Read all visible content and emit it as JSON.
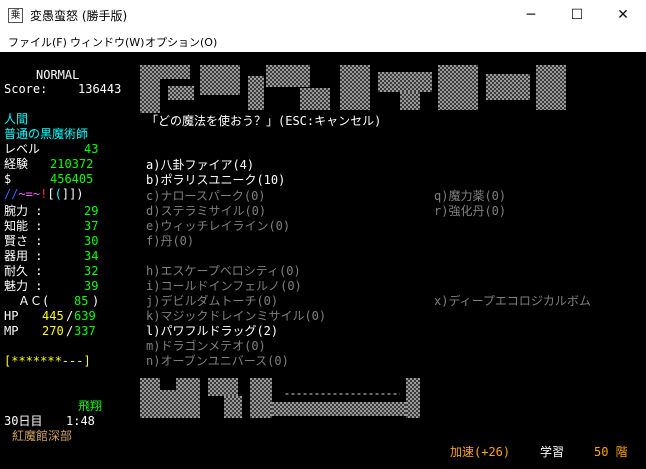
{
  "window": {
    "title": "変愚蛮怒 (勝手版)",
    "icon_glyph": "乗",
    "btn_minimize": "─",
    "btn_maximize": "☐",
    "btn_close": "✕"
  },
  "menu": {
    "file": "ファイル(F)",
    "window": "ウィンドウ(W)",
    "options": "オプション(O)"
  },
  "status": {
    "difficulty": "NORMAL",
    "score_label": "Score:",
    "score": "136443",
    "race": "人間",
    "class": "普通の黒魔術師",
    "level_label": "レベル",
    "level": "43",
    "exp_label": "経験",
    "exp": "210372",
    "gold_label": "$",
    "gold": "456405",
    "equip": "//~=~![(]])",
    "stats": [
      {
        "label": "腕力 :",
        "value": "29"
      },
      {
        "label": "知能 :",
        "value": "37"
      },
      {
        "label": "賢さ :",
        "value": "30"
      },
      {
        "label": "器用 :",
        "value": "34"
      },
      {
        "label": "耐久 :",
        "value": "32"
      },
      {
        "label": "魅力 :",
        "value": "39"
      }
    ],
    "ac_label": "ＡＣ(",
    "ac": "85",
    "ac_close": ")",
    "hp_label": "HP",
    "hp": "445",
    "hp_max": "639",
    "mp_label": "MP",
    "mp": "270",
    "mp_max": "337",
    "health_bar": "[*******---]",
    "flying": "飛翔",
    "day": "30日目",
    "time": "1:48",
    "location": "紅魔館深部"
  },
  "prompt": "「どの魔法を使おう？」(ESC:キャンセル)",
  "spells": {
    "a": "a)八卦ファイア(4)",
    "b": "b)ポラリスユニーク(10)",
    "c": "c)ナロースパーク(0)",
    "d": "d)ステラミサイル(0)",
    "e": "e)ウィッチレイライン(0)",
    "f": "f)丹(0)",
    "h": "h)エスケープベロシティ(0)",
    "i": "i)コールドインフェルノ(0)",
    "j": "j)デビルダムトーチ(0)",
    "k": "k)マジックドレインミサイル(0)",
    "l": "l)パワフルドラッグ(2)",
    "m": "m)ドラゴンメテオ(0)",
    "n": "n)オーブンユニバース(0)",
    "q": "q)魔力薬(0)",
    "r": "r)強化丹(0)",
    "x": "x)ディープエコロジカルボム"
  },
  "bottom": {
    "speed": "加速(+26)",
    "study": "学習",
    "depth": "50 階"
  },
  "colors": {
    "white": "#ffffff",
    "cyan": "#00ffff",
    "green": "#00ff00",
    "gray": "#7f7f7f",
    "yellow": "#ffff00",
    "orange": "#ffa500"
  }
}
